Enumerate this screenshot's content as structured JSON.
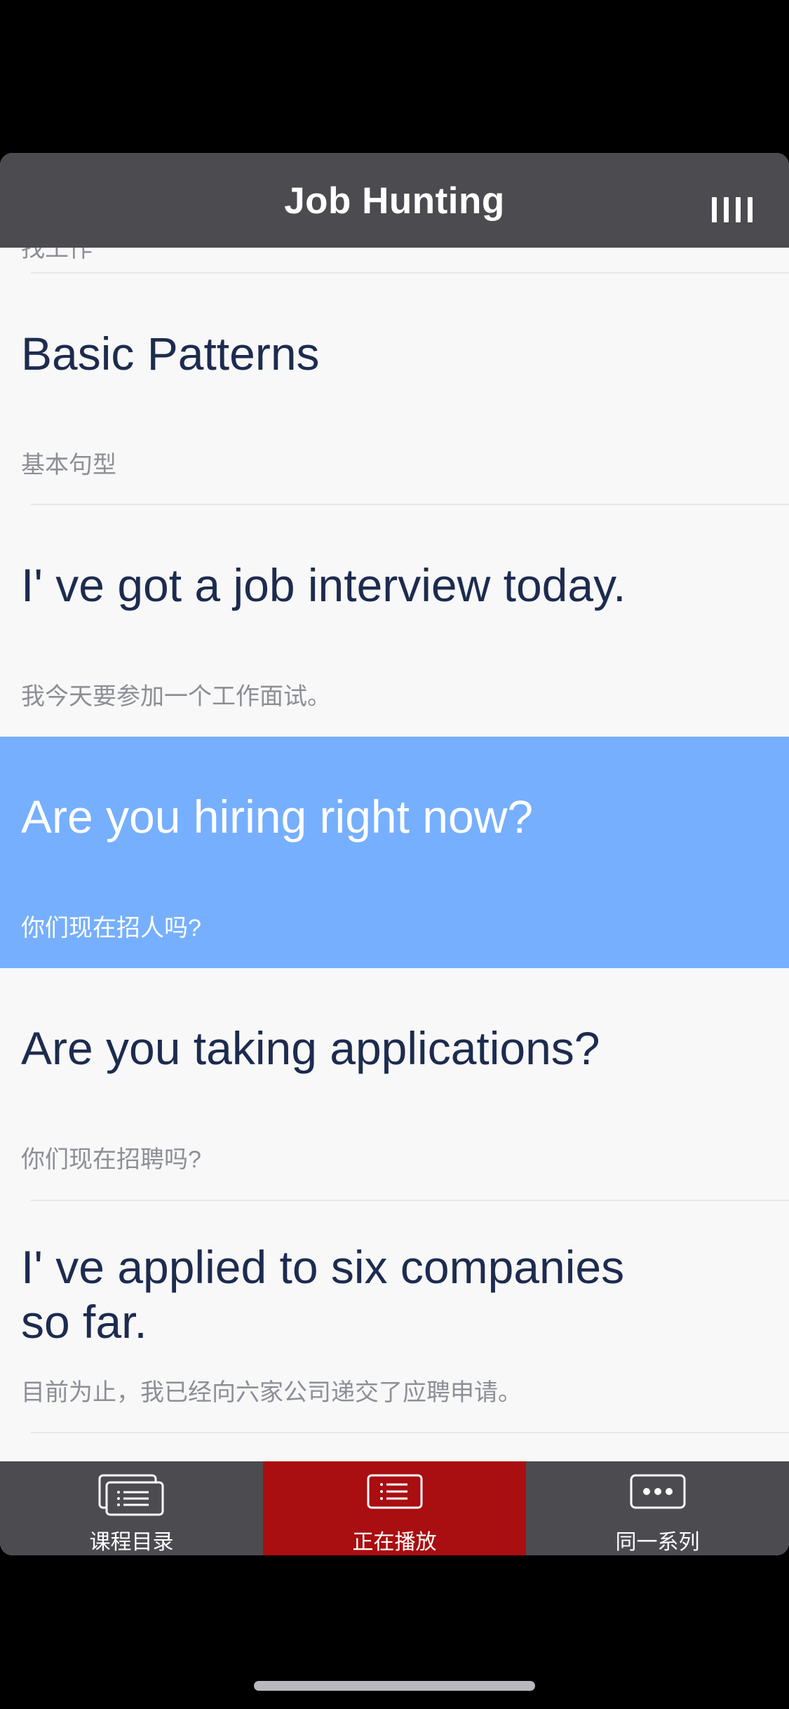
{
  "header": {
    "title": "Job Hunting"
  },
  "list": {
    "partial_sub": "找工作",
    "items": [
      {
        "en": "Basic Patterns",
        "cn": "基本句型"
      },
      {
        "en": "I' ve got a job interview today.",
        "cn": "我今天要参加一个工作面试。"
      },
      {
        "en": "Are you hiring right now?",
        "cn": "你们现在招人吗?"
      },
      {
        "en": "Are you taking applications?",
        "cn": "你们现在招聘吗?"
      },
      {
        "en": "I' ve applied to six companies so far.",
        "cn": "目前为止，我已经向六家公司递交了应聘申请。"
      }
    ],
    "active_index": 2
  },
  "tabbar": {
    "tabs": [
      {
        "label": "课程目录",
        "icon": "course-list-icon"
      },
      {
        "label": "正在播放",
        "icon": "now-playing-list-icon"
      },
      {
        "label": "同一系列",
        "icon": "more-dots-icon"
      }
    ],
    "active_index": 1
  },
  "colors": {
    "header_bg": "#4c4b50",
    "active_row": "#76affe",
    "active_tab": "#a90e11",
    "title_text": "#1d2b4f",
    "sub_text": "#8d8f96",
    "page_bg": "#f8f8f8"
  }
}
